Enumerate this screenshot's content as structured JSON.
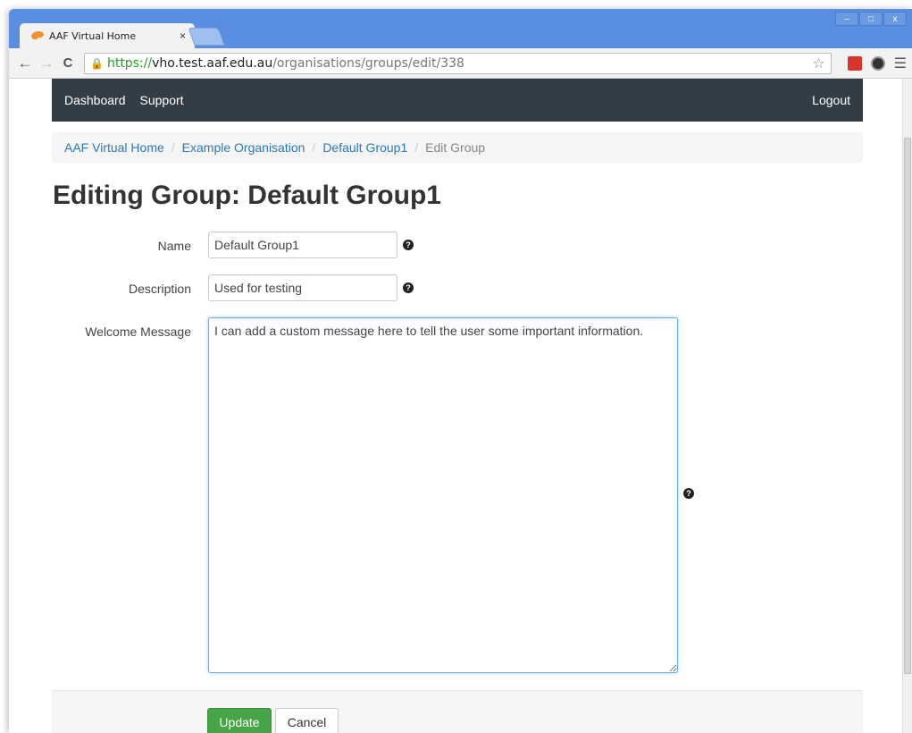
{
  "browser": {
    "tab_title": "AAF Virtual Home",
    "tab_close": "×",
    "url_scheme": "https://",
    "url_host": "vho.test.aaf.edu.au",
    "url_path": "/organisations/groups/edit/338",
    "window_controls": [
      "‒",
      "□",
      "x"
    ]
  },
  "navbar": {
    "items": [
      "Dashboard",
      "Support"
    ],
    "logout": "Logout",
    "bg_color": "#333d45"
  },
  "breadcrumb": {
    "items": [
      "AAF Virtual Home",
      "Example Organisation",
      "Default Group1"
    ],
    "separator": "/",
    "active": "Edit Group"
  },
  "page": {
    "title": "Editing Group: Default Group1"
  },
  "form": {
    "name_label": "Name",
    "name_value": "Default Group1",
    "description_label": "Description",
    "description_value": "Used for testing",
    "welcome_label": "Welcome Message",
    "welcome_value": "I can add a custom message here to tell the user some important information.",
    "help_glyph": "?"
  },
  "actions": {
    "update_label": "Update",
    "cancel_label": "Cancel",
    "update_color": "#47a447"
  },
  "icons": {
    "back": "arrow-left-icon",
    "forward": "arrow-right-icon",
    "reload": "reload-icon",
    "lock": "lock-icon",
    "bookmark": "star-icon",
    "menu": "hamburger-menu-icon"
  }
}
